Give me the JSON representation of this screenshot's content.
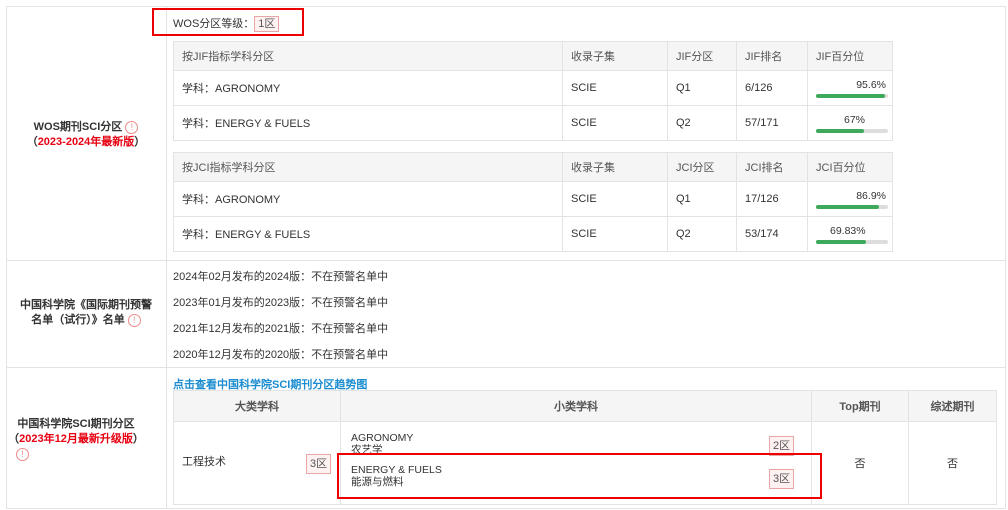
{
  "wos": {
    "label_line1": "WOS期刊SCI分区",
    "label_line2_prefix": "（",
    "label_line2_red": "2023-2024年最新版",
    "label_line2_suffix": "）",
    "grade_label": "WOS分区等级：",
    "grade_value": "1区",
    "jif_headers": [
      "按JIF指标学科分区",
      "收录子集",
      "JIF分区",
      "JIF排名",
      "JIF百分位"
    ],
    "jif_rows": [
      {
        "subject": "学科：AGRONOMY",
        "subset": "SCIE",
        "quartile": "Q1",
        "rank": "6/126",
        "pct_text": "95.6%",
        "pct": 95.6
      },
      {
        "subject": "学科：ENERGY & FUELS",
        "subset": "SCIE",
        "quartile": "Q2",
        "rank": "57/171",
        "pct_text": "67%",
        "pct": 67
      }
    ],
    "jci_headers": [
      "按JCI指标学科分区",
      "收录子集",
      "JCI分区",
      "JCI排名",
      "JCI百分位"
    ],
    "jci_rows": [
      {
        "subject": "学科：AGRONOMY",
        "subset": "SCIE",
        "quartile": "Q1",
        "rank": "17/126",
        "pct_text": "86.9%",
        "pct": 86.9
      },
      {
        "subject": "学科：ENERGY & FUELS",
        "subset": "SCIE",
        "quartile": "Q2",
        "rank": "53/174",
        "pct_text": "69.83%",
        "pct": 69.83
      }
    ]
  },
  "warning": {
    "label_line1": "中国科学院《国际期刊预警",
    "label_line2": "名单（试行）》名单",
    "items": [
      "2024年02月发布的2024版：不在预警名单中",
      "2023年01月发布的2023版：不在预警名单中",
      "2021年12月发布的2021版：不在预警名单中",
      "2020年12月发布的2020版：不在预警名单中"
    ]
  },
  "cas": {
    "label_line1": "中国科学院SCI期刊分区",
    "label_line2_prefix": "（",
    "label_line2_red": "2023年12月最新升级版",
    "label_line2_suffix": "）",
    "link": "点击查看中国科学院SCI期刊分区趋势图",
    "headers": [
      "大类学科",
      "小类学科",
      "Top期刊",
      "综述期刊"
    ],
    "major": "工程技术",
    "major_zone": "3区",
    "minors": [
      {
        "en": "AGRONOMY",
        "cn": "农艺学",
        "zone": "2区"
      },
      {
        "en": "ENERGY & FUELS",
        "cn": "能源与燃料",
        "zone": "3区"
      }
    ],
    "top": "否",
    "review": "否"
  },
  "colors": {
    "accent_red": "#e60012",
    "bar_green": "#3caa5a",
    "link_blue": "#1a8ccf"
  },
  "icons": {
    "warning": "exclamation-circle-icon"
  }
}
